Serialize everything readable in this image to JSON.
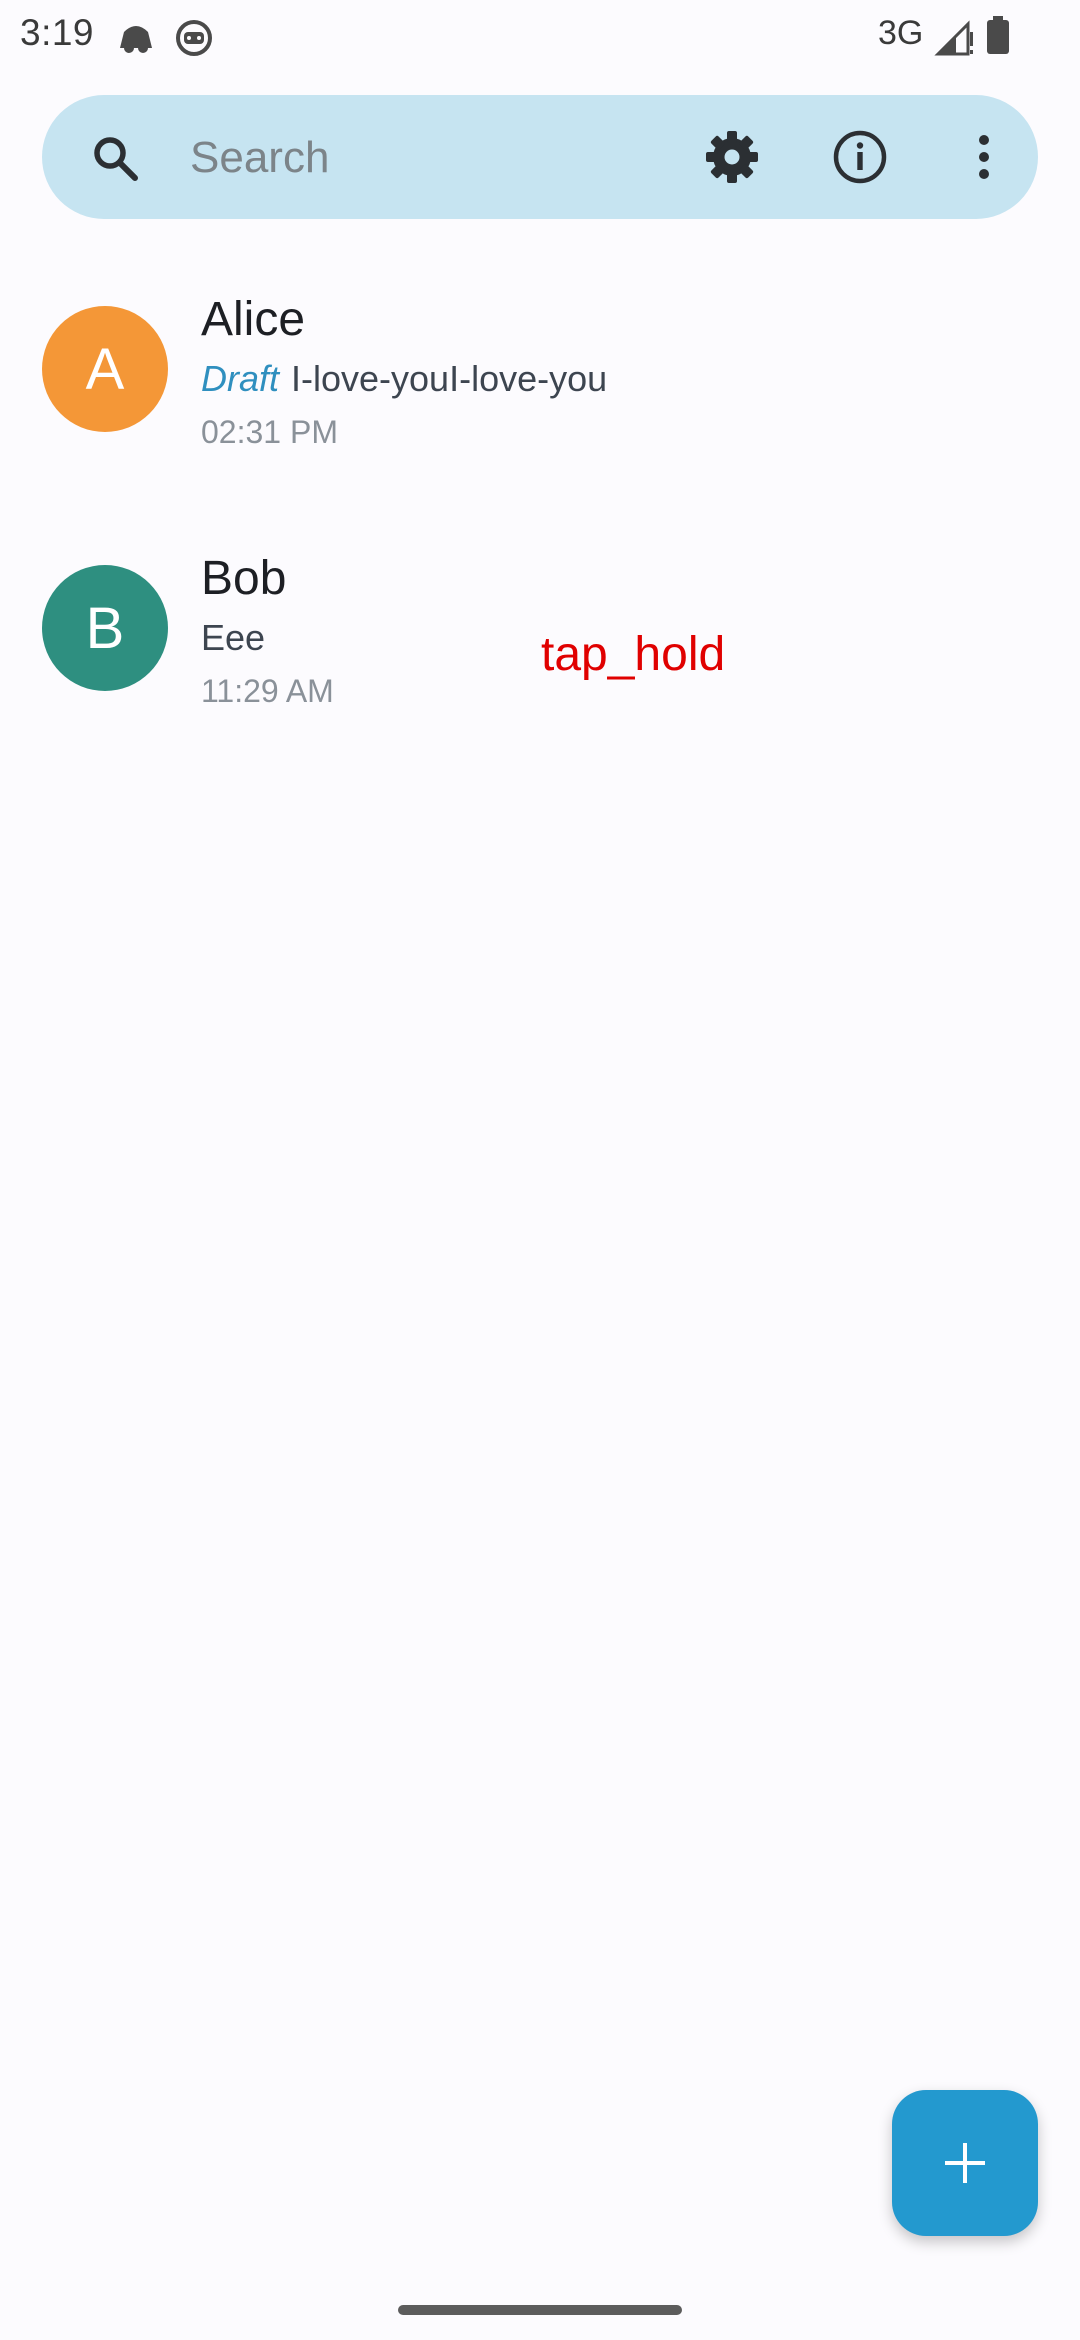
{
  "status_bar": {
    "time": "3:19",
    "network": "3G",
    "icons": [
      "cloud-notification-icon",
      "android-notification-icon",
      "signal-icon",
      "battery-icon"
    ]
  },
  "search": {
    "placeholder": "Search",
    "value": "",
    "icons": [
      "search-icon",
      "settings-icon",
      "info-icon",
      "more-options-icon"
    ]
  },
  "conversations": [
    {
      "avatar_letter": "A",
      "avatar_color": "#f49737",
      "name": "Alice",
      "draft_label": "Draft",
      "snippet": "I-love-youI-love-you",
      "time": "02:31 PM"
    },
    {
      "avatar_letter": "B",
      "avatar_color": "#2e8f80",
      "name": "Bob",
      "snippet": "Eee",
      "time": "11:29 AM"
    }
  ],
  "overlay": {
    "annotation": "tap_hold"
  },
  "fab": {
    "icon": "plus-icon"
  },
  "colors": {
    "background": "#fcfbfe",
    "search_bar": "#c6e4f1",
    "accent": "#2399cf",
    "draft": "#2f8fbf",
    "annotation": "#e00000"
  }
}
